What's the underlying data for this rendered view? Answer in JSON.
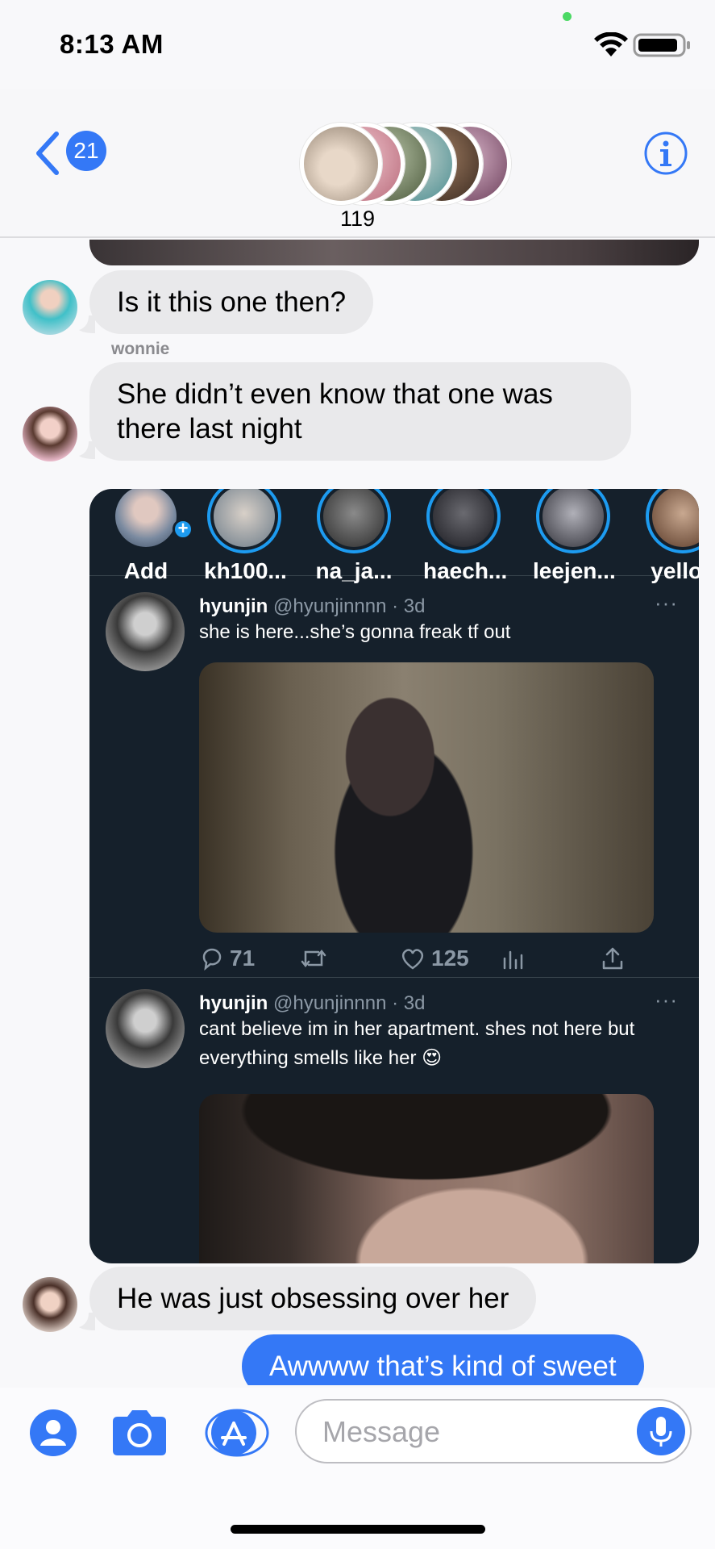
{
  "status_bar": {
    "time": "8:13 AM"
  },
  "header": {
    "back_badge": "21",
    "member_count": "119"
  },
  "messages": [
    {
      "type": "incoming",
      "text": "Is it this one then?"
    },
    {
      "type": "incoming",
      "sender": "wonnie",
      "text": "She didn’t even know that one was there last night"
    },
    {
      "type": "incoming",
      "text": "He was just obsessing over her"
    },
    {
      "type": "outgoing",
      "text": "Awwww that’s kind of sweet"
    }
  ],
  "tweet_card": {
    "fleets": [
      {
        "label": "Add"
      },
      {
        "label": "kh100..."
      },
      {
        "label": "na_ja..."
      },
      {
        "label": "haech..."
      },
      {
        "label": "leejen..."
      },
      {
        "label": "yellov"
      }
    ],
    "tweets": [
      {
        "name": "hyunjin",
        "handle_time": "@hyunjinnnn · 3d",
        "text": "she is here...she’s gonna freak tf out",
        "replies": "71",
        "likes": "125"
      },
      {
        "name": "hyunjin",
        "handle_time": "@hyunjinnnn · 3d",
        "text": "cant believe im in her apartment. shes not here but everything smells like her 😍"
      }
    ],
    "more": "···"
  },
  "composer": {
    "placeholder": "Message"
  },
  "colors": {
    "accent": "#3478f6",
    "incoming_bubble": "#e9e9eb",
    "tweet_bg": "#15202b"
  },
  "icons": [
    "wifi-icon",
    "battery-icon",
    "chevron-left-icon",
    "info-icon",
    "reply-icon",
    "retweet-icon",
    "heart-icon",
    "analytics-icon",
    "share-icon",
    "contact-icon",
    "camera-icon",
    "app-store-icon",
    "microphone-icon"
  ]
}
